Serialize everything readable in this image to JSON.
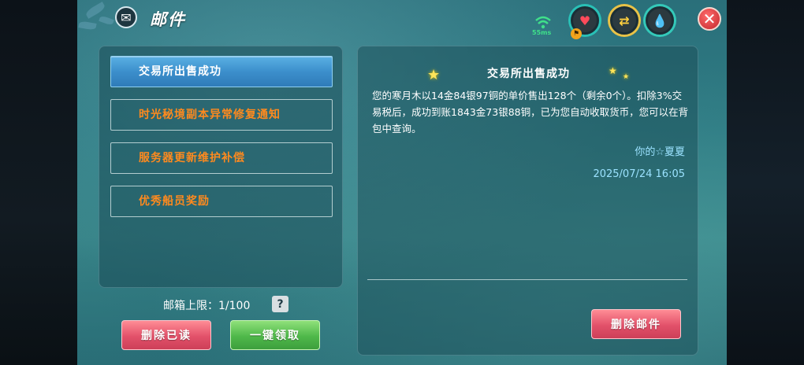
{
  "header": {
    "title": "邮件",
    "ping": "55ms"
  },
  "status_icons": [
    {
      "icon": "heart-icon",
      "color": "#ff4a5a"
    },
    {
      "icon": "swap-arrows-icon",
      "color": "#ffcf3e"
    },
    {
      "icon": "water-drop-icon",
      "color": "#35d6c9"
    }
  ],
  "mail_list": [
    {
      "title": "交易所出售成功",
      "selected": true
    },
    {
      "title": "时光秘境副本异常修复通知",
      "selected": false
    },
    {
      "title": "服务器更新维护补偿",
      "selected": false
    },
    {
      "title": "优秀船员奖励",
      "selected": false
    }
  ],
  "mailbox": {
    "limit_label": "邮箱上限：",
    "limit_value": "1/100",
    "help": "?"
  },
  "buttons": {
    "delete_read": "删除已读",
    "claim_all": "一键领取",
    "delete_mail": "删除邮件"
  },
  "message": {
    "title": "交易所出售成功",
    "body": "您的寒月木以14金84银97铜的单价售出128个（剩余0个）。扣除3%交易税后，成功到账1843金73银88铜，已为您自动收取货币，您可以在背包中查询。",
    "sender": "你的☆夏夏",
    "date": "2025/07/24 16:05"
  }
}
